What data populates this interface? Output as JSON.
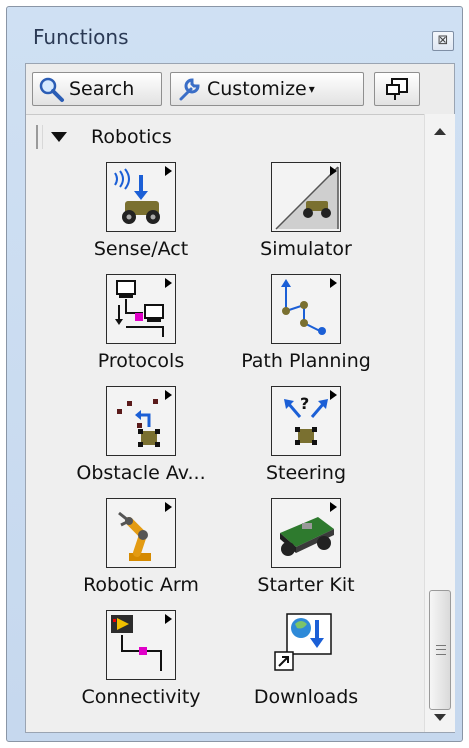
{
  "window": {
    "title": "Functions",
    "close_glyph": "⊠"
  },
  "toolbar": {
    "search_label": "Search",
    "customize_label": "Customize",
    "customize_arrow": "▾"
  },
  "palette": {
    "section_label": "Robotics",
    "items": [
      {
        "label": "Sense/Act",
        "icon": "sense-act-icon"
      },
      {
        "label": "Simulator",
        "icon": "simulator-icon"
      },
      {
        "label": "Protocols",
        "icon": "protocols-icon"
      },
      {
        "label": "Path Planning",
        "icon": "path-planning-icon"
      },
      {
        "label": "Obstacle Av...",
        "icon": "obstacle-avoidance-icon"
      },
      {
        "label": "Steering",
        "icon": "steering-icon"
      },
      {
        "label": "Robotic Arm",
        "icon": "robotic-arm-icon"
      },
      {
        "label": "Starter Kit",
        "icon": "starter-kit-icon"
      },
      {
        "label": "Connectivity",
        "icon": "connectivity-icon"
      },
      {
        "label": "Downloads",
        "icon": "downloads-icon"
      }
    ]
  },
  "colors": {
    "frame": "#c6d8ee",
    "panel": "#efefef",
    "accent_blue": "#1b5fd6"
  }
}
